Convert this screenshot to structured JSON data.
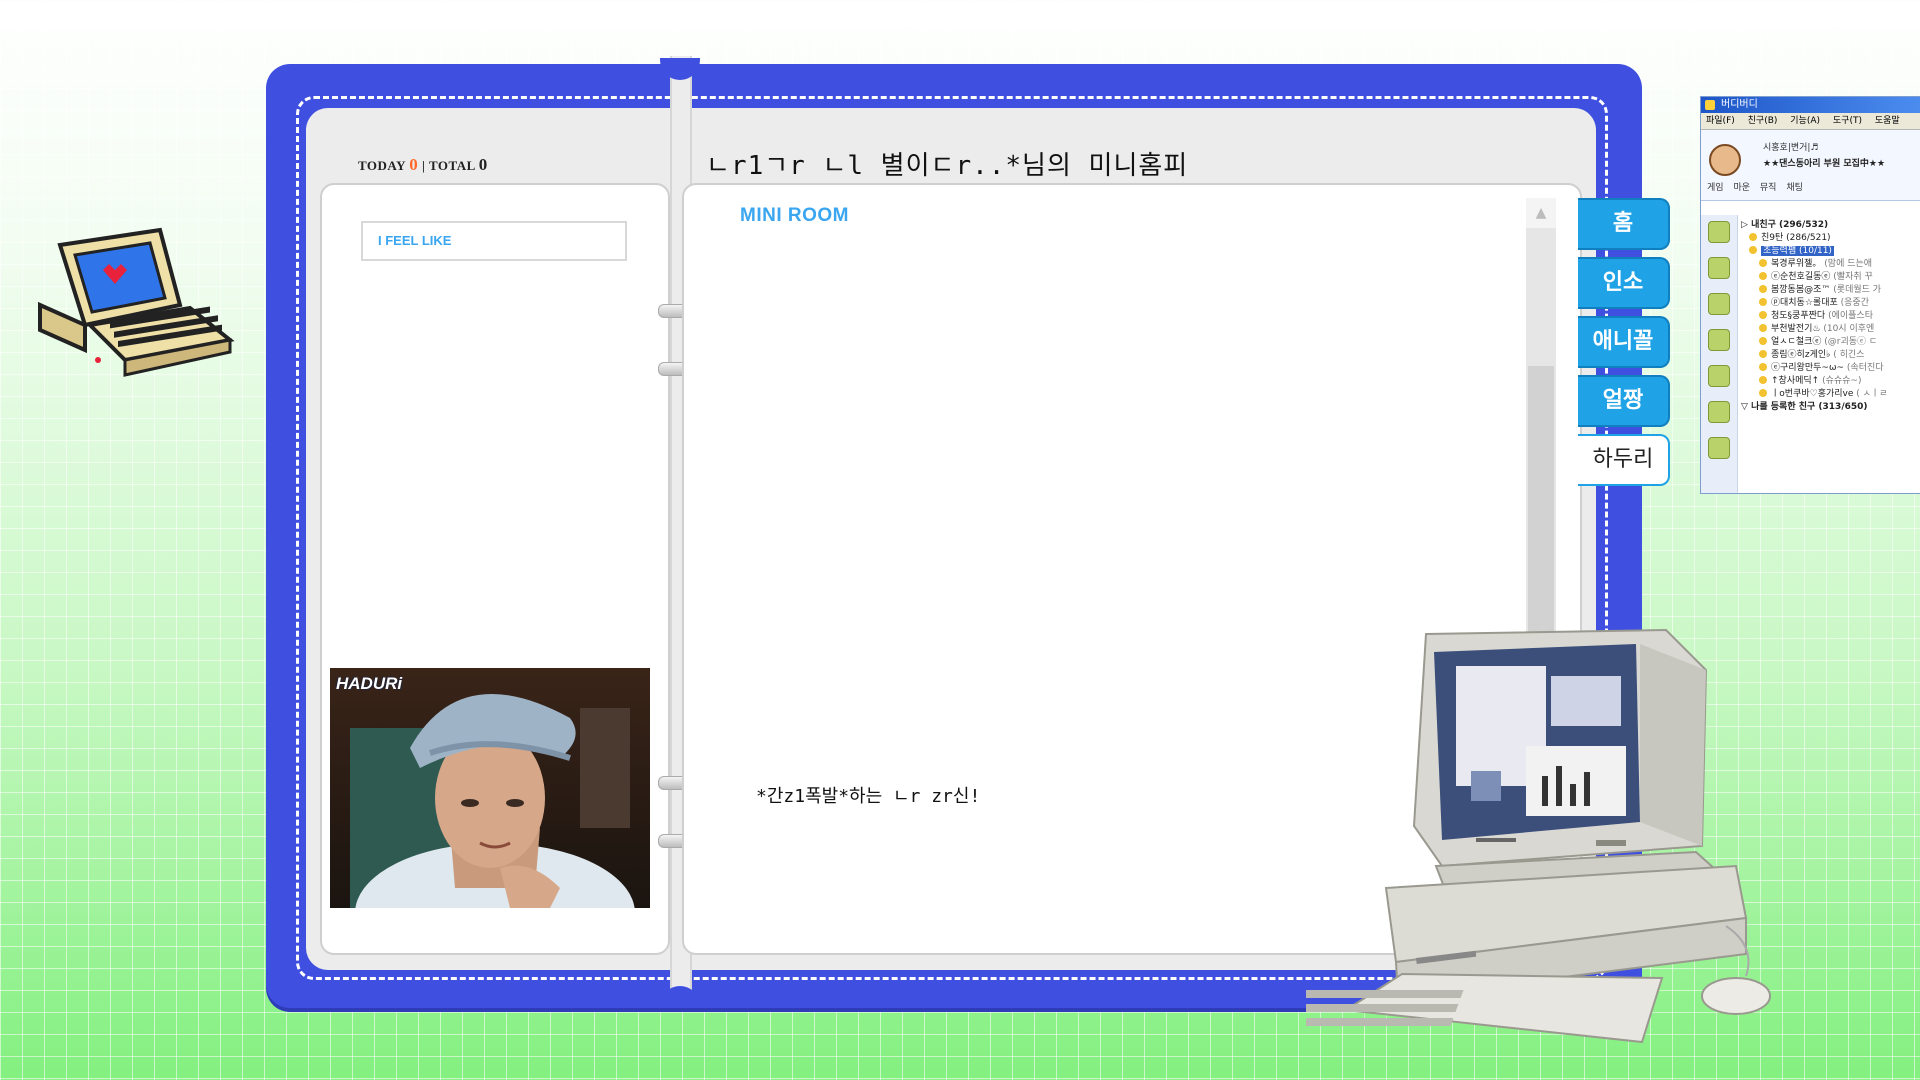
{
  "counter": {
    "today_label": "TODAY",
    "today_value": "0",
    "separator": "|",
    "total_label": "TOTAL",
    "total_value": "0"
  },
  "page_title": "ㄴr1ㄱr ㄴl 별이ㄷr..*님의 미니홈피",
  "left_panel": {
    "feel_like_label": "I FEEL LIKE",
    "photo_caption": "HADURi"
  },
  "main": {
    "section_title": "MINI ROOM",
    "greeting": "*간z1폭발*하는 ㄴr zr신!"
  },
  "tabs": [
    "홈",
    "인소",
    "애니꼴",
    "얼짱",
    "하두리"
  ],
  "active_tab": "하두리",
  "buddy_window": {
    "title": "버디버디",
    "menu": [
      "파일(F)",
      "친구(B)",
      "기능(A)",
      "도구(T)",
      "도움말"
    ],
    "status": "시홍호|변거|♬",
    "banner": "★★댄스동아리 부원 모집中★★",
    "actions": [
      "게임",
      "마운",
      "뮤직",
      "채팅"
    ],
    "groups": [
      {
        "name": "내친구 (296/532)",
        "type": "group"
      },
      {
        "name": "친9탄 (286/521)",
        "type": "group"
      },
      {
        "name": "초능력팸 (10/11)",
        "type": "selected"
      }
    ],
    "buddies": [
      {
        "name": "복경루위젤。",
        "status": "(맘에 드는애"
      },
      {
        "name": "ⓔ순천호길동ⓔ",
        "status": "(빨자취 꾸"
      },
      {
        "name": "봄깡동봄@조™",
        "status": "(롯데월드 가"
      },
      {
        "name": "ⓟ대치동☆롤대포",
        "status": "(응중간"
      },
      {
        "name": "청도§쿵푸짠다",
        "status": "(에이플스타"
      },
      {
        "name": "부천발전기♨",
        "status": "(10시 이후엔"
      },
      {
        "name": "얼ㅅㄷ철크ⓔ",
        "status": "(@r괴동ⓔ ㄷ"
      },
      {
        "name": "종림ⓔ히z게인♭",
        "status": "( 히긴스"
      },
      {
        "name": "ⓔ구리왕만두~ω~",
        "status": "(속터진다"
      },
      {
        "name": "↑창사메딕↑",
        "status": "(슈슈슈~)"
      },
      {
        "name": "ㅣo번쿠바♡홍가리ve",
        "status": "( ㅅㅣㄹ"
      }
    ],
    "registered": "나를 등록한 친구 (313/650)",
    "sidebar": [
      "Buddy",
      "Homepy",
      "Avatar",
      "Game",
      "Music",
      "Event",
      "Memo"
    ]
  },
  "colors": {
    "binder_blue": "#3f4fe0",
    "tab_blue": "#20a2e6",
    "accent_orange": "#ff6a2a",
    "accent_sky": "#3aa6f0"
  },
  "icons": {
    "retro_computer": "retro-computer-heart-icon",
    "desktop_computer": "beige-desktop-computer-icon",
    "scroll_up": "triangle-up-icon"
  }
}
